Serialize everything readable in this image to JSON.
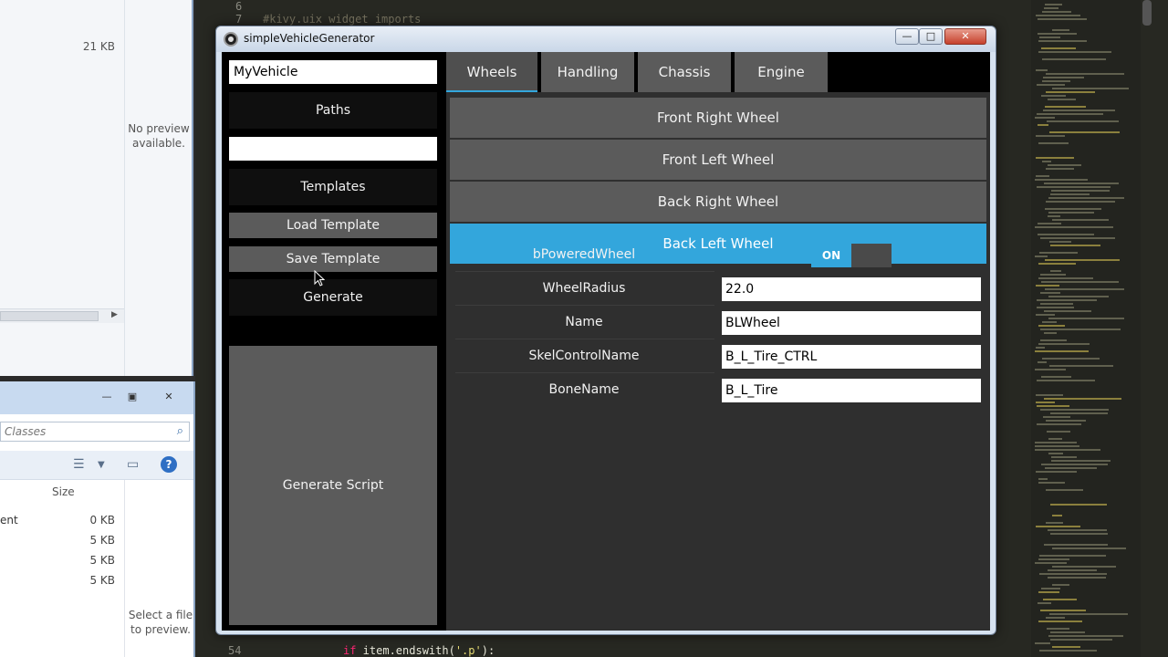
{
  "background": {
    "explorer_top": {
      "size_value": "21 KB",
      "preview_text": "No preview available."
    },
    "explorer_bottom": {
      "search_placeholder": "Classes",
      "size_header": "Size",
      "rows": [
        {
          "label": "ent",
          "size": "0 KB"
        },
        {
          "label": "",
          "size": "5 KB"
        },
        {
          "label": "",
          "size": "5 KB"
        },
        {
          "label": "",
          "size": "5 KB"
        }
      ],
      "preview_text": "Select a file to preview."
    },
    "editor": {
      "line_top_num": "6",
      "line_second_num": "7",
      "line_second_code": "#kivy.uix widget imports",
      "line_bottom_num": "54",
      "line_bottom_code_kw": "if",
      "line_bottom_code_rest": " item.endswith(",
      "line_bottom_code_str": "'.p'",
      "line_bottom_code_end": "):"
    }
  },
  "app": {
    "title": "simpleVehicleGenerator",
    "win_buttons": {
      "minimize": "—",
      "maximize": "□",
      "close": "✕"
    },
    "left": {
      "vehicle_name_value": "MyVehicle",
      "paths_label": "Paths",
      "path_value": "",
      "templates_label": "Templates",
      "load_template_label": "Load Template",
      "save_template_label": "Save Template",
      "generate_label": "Generate",
      "generate_script_label": "Generate Script"
    },
    "tabs": [
      {
        "label": "Wheels",
        "active": true
      },
      {
        "label": "Handling",
        "active": false
      },
      {
        "label": "Chassis",
        "active": false
      },
      {
        "label": "Engine",
        "active": false
      }
    ],
    "wheels": [
      {
        "label": "Front Right Wheel",
        "active": false
      },
      {
        "label": "Front Left Wheel",
        "active": false
      },
      {
        "label": "Back Right Wheel",
        "active": false
      },
      {
        "label": "Back Left Wheel",
        "active": true
      }
    ],
    "props": {
      "powered_label": "bPoweredWheel",
      "powered_state": "ON",
      "radius_label": "WheelRadius",
      "radius_value": "22.0",
      "name_label": "Name",
      "name_value": "BLWheel",
      "skel_label": "SkelControlName",
      "skel_value": "B_L_Tire_CTRL",
      "bone_label": "BoneName",
      "bone_value": "B_L_Tire"
    }
  },
  "colors": {
    "accent": "#33a6dc",
    "button_grey": "#5b5b5b",
    "panel_bg": "#2f2f2f"
  }
}
